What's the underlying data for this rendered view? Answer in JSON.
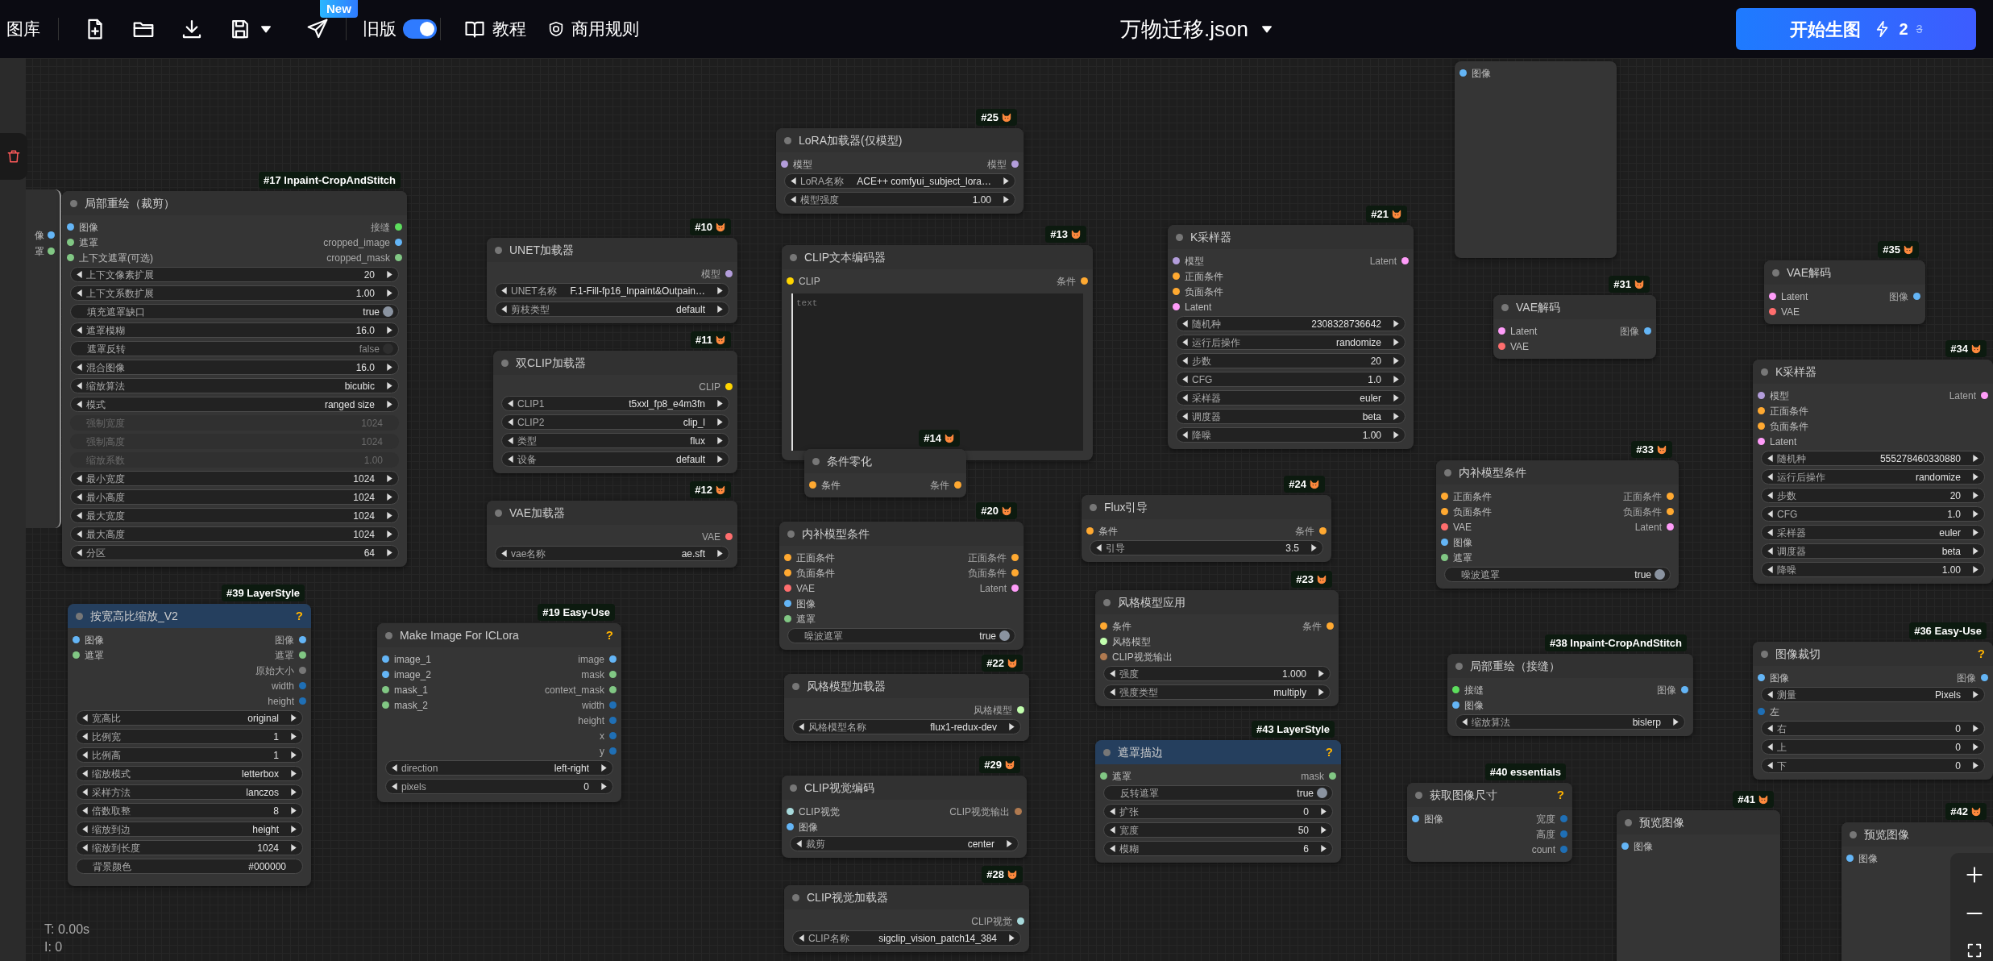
{
  "toolbar": {
    "gallery": "图库",
    "new_badge": "New",
    "old_version": {
      "label": "旧版",
      "on": true
    },
    "tutorial": "教程",
    "rules": "商用规则",
    "file_name": "万物迁移.json",
    "run": {
      "label": "开始生图",
      "count": "2",
      "old_count": "3"
    }
  },
  "left_stub": {
    "labels": [
      "像",
      "罩"
    ]
  },
  "nodes": [
    {
      "tag": "#17 Inpaint-CropAndStitch",
      "fox": false,
      "title": "局部重绘（裁剪）",
      "highlighted": false,
      "rows": [
        {
          "kind": "ports",
          "in": {
            "label": "图像",
            "color": "#64b5f6"
          },
          "out": {
            "label": "接缝",
            "color": "#5dde5d"
          }
        },
        {
          "kind": "ports",
          "in": {
            "label": "遮罩",
            "color": "#81c784"
          },
          "out": {
            "label": "cropped_image",
            "color": "#64b5f6"
          }
        },
        {
          "kind": "ports",
          "in": {
            "label": "上下文遮罩(可选)",
            "color": "#81c784"
          },
          "out": {
            "label": "cropped_mask",
            "color": "#81c784"
          }
        },
        {
          "kind": "stepper",
          "label": "上下文像素扩展",
          "value": "20"
        },
        {
          "kind": "stepper",
          "label": "上下文系数扩展",
          "value": "1.00"
        },
        {
          "kind": "toggle",
          "label": "填充遮罩缺口",
          "value": "true",
          "on": true
        },
        {
          "kind": "stepper",
          "label": "遮罩模糊",
          "value": "16.0"
        },
        {
          "kind": "toggle",
          "label": "遮罩反转",
          "value": "false",
          "on": false
        },
        {
          "kind": "stepper",
          "label": "混合图像",
          "value": "16.0"
        },
        {
          "kind": "stepper",
          "label": "缩放算法",
          "value": "bicubic"
        },
        {
          "kind": "stepper",
          "label": "模式",
          "value": "ranged size"
        },
        {
          "kind": "inactive",
          "label": "强制宽度",
          "value": "1024"
        },
        {
          "kind": "inactive",
          "label": "强制高度",
          "value": "1024"
        },
        {
          "kind": "inactive",
          "label": "缩放系数",
          "value": "1.00"
        },
        {
          "kind": "stepper",
          "label": "最小宽度",
          "value": "1024"
        },
        {
          "kind": "stepper",
          "label": "最小高度",
          "value": "1024"
        },
        {
          "kind": "stepper",
          "label": "最大宽度",
          "value": "1024"
        },
        {
          "kind": "stepper",
          "label": "最大高度",
          "value": "1024"
        },
        {
          "kind": "stepper",
          "label": "分区",
          "value": "64"
        }
      ]
    },
    {
      "tag": "#10",
      "fox": true,
      "title": "UNET加载器",
      "highlighted": false,
      "rows": [
        {
          "kind": "ports",
          "out": {
            "label": "模型",
            "color": "#b39ddb"
          }
        },
        {
          "kind": "stepper",
          "label": "UNET名称",
          "value": "F.1-Fill-fp16_Inpaint&Outpain…"
        },
        {
          "kind": "stepper",
          "label": "剪枝类型",
          "value": "default"
        }
      ]
    },
    {
      "tag": "#11",
      "fox": true,
      "title": "双CLIP加载器",
      "highlighted": false,
      "rows": [
        {
          "kind": "ports",
          "out": {
            "label": "CLIP",
            "color": "#ffd500"
          }
        },
        {
          "kind": "stepper",
          "label": "CLIP1",
          "value": "t5xxl_fp8_e4m3fn"
        },
        {
          "kind": "stepper",
          "label": "CLIP2",
          "value": "clip_l"
        },
        {
          "kind": "stepper",
          "label": "类型",
          "value": "flux"
        },
        {
          "kind": "stepper",
          "label": "设备",
          "value": "default"
        }
      ]
    },
    {
      "tag": "#12",
      "fox": true,
      "title": "VAE加载器",
      "highlighted": false,
      "rows": [
        {
          "kind": "ports",
          "out": {
            "label": "VAE",
            "color": "#ff6e6e"
          }
        },
        {
          "kind": "stepper",
          "label": "vae名称",
          "value": "ae.sft"
        }
      ]
    },
    {
      "tag": "#25",
      "fox": true,
      "title": "LoRA加载器(仅模型)",
      "highlighted": false,
      "rows": [
        {
          "kind": "ports",
          "in": {
            "label": "模型",
            "color": "#b39ddb"
          },
          "out": {
            "label": "模型",
            "color": "#b39ddb"
          }
        },
        {
          "kind": "stepper",
          "label": "LoRA名称",
          "value": "ACE++ comfyui_subject_lora…"
        },
        {
          "kind": "stepper",
          "label": "模型强度",
          "value": "1.00"
        }
      ]
    },
    {
      "tag": "#13",
      "fox": true,
      "title": "CLIP文本编码器",
      "highlighted": false,
      "rows": [
        {
          "kind": "ports",
          "in": {
            "label": "CLIP",
            "color": "#ffd500"
          },
          "out": {
            "label": "条件",
            "color": "#ffa931"
          }
        },
        {
          "kind": "textarea",
          "placeholder": "text"
        }
      ]
    },
    {
      "tag": "#14",
      "fox": true,
      "title": "条件零化",
      "highlighted": false,
      "rows": [
        {
          "kind": "ports",
          "in": {
            "label": "条件",
            "color": "#ffa931"
          },
          "out": {
            "label": "条件",
            "color": "#ffa931"
          }
        }
      ]
    },
    {
      "tag": "#21",
      "fox": true,
      "title": "K采样器",
      "highlighted": false,
      "rows": [
        {
          "kind": "ports",
          "in": {
            "label": "模型",
            "color": "#b39ddb"
          },
          "out": {
            "label": "Latent",
            "color": "#ff9cf9"
          }
        },
        {
          "kind": "ports",
          "in": {
            "label": "正面条件",
            "color": "#ffa931"
          }
        },
        {
          "kind": "ports",
          "in": {
            "label": "负面条件",
            "color": "#ffa931"
          }
        },
        {
          "kind": "ports",
          "in": {
            "label": "Latent",
            "color": "#ff9cf9"
          }
        },
        {
          "kind": "stepper",
          "label": "随机种",
          "value": "2308328736642"
        },
        {
          "kind": "stepper",
          "label": "运行后操作",
          "value": "randomize"
        },
        {
          "kind": "stepper",
          "label": "步数",
          "value": "20"
        },
        {
          "kind": "stepper",
          "label": "CFG",
          "value": "1.0"
        },
        {
          "kind": "stepper",
          "label": "采样器",
          "value": "euler"
        },
        {
          "kind": "stepper",
          "label": "调度器",
          "value": "beta"
        },
        {
          "kind": "stepper",
          "label": "降噪",
          "value": "1.00"
        }
      ]
    },
    {
      "rows": [
        {
          "kind": "ports",
          "in": {
            "label": "图像",
            "color": "#64b5f6"
          }
        }
      ]
    },
    {
      "tag": "#31",
      "fox": true,
      "title": "VAE解码",
      "highlighted": false,
      "rows": [
        {
          "kind": "ports",
          "in": {
            "label": "Latent",
            "color": "#ff9cf9"
          },
          "out": {
            "label": "图像",
            "color": "#64b5f6"
          }
        },
        {
          "kind": "ports",
          "in": {
            "label": "VAE",
            "color": "#ff6e6e"
          }
        }
      ]
    },
    {
      "tag": "#35",
      "fox": true,
      "title": "VAE解码",
      "highlighted": false,
      "rows": [
        {
          "kind": "ports",
          "in": {
            "label": "Latent",
            "color": "#ff9cf9"
          },
          "out": {
            "label": "图像",
            "color": "#64b5f6"
          }
        },
        {
          "kind": "ports",
          "in": {
            "label": "VAE",
            "color": "#ff6e6e"
          }
        }
      ]
    },
    {
      "tag": "#34",
      "fox": true,
      "title": "K采样器",
      "highlighted": false,
      "rows": [
        {
          "kind": "ports",
          "in": {
            "label": "模型",
            "color": "#b39ddb"
          },
          "out": {
            "label": "Latent",
            "color": "#ff9cf9"
          }
        },
        {
          "kind": "ports",
          "in": {
            "label": "正面条件",
            "color": "#ffa931"
          }
        },
        {
          "kind": "ports",
          "in": {
            "label": "负面条件",
            "color": "#ffa931"
          }
        },
        {
          "kind": "ports",
          "in": {
            "label": "Latent",
            "color": "#ff9cf9"
          }
        },
        {
          "kind": "stepper",
          "label": "随机种",
          "value": "555278460330880"
        },
        {
          "kind": "stepper",
          "label": "运行后操作",
          "value": "randomize"
        },
        {
          "kind": "stepper",
          "label": "步数",
          "value": "20"
        },
        {
          "kind": "stepper",
          "label": "CFG",
          "value": "1.0"
        },
        {
          "kind": "stepper",
          "label": "采样器",
          "value": "euler"
        },
        {
          "kind": "stepper",
          "label": "调度器",
          "value": "beta"
        },
        {
          "kind": "stepper",
          "label": "降噪",
          "value": "1.00"
        }
      ]
    },
    {
      "tag": "#24",
      "fox": true,
      "title": "Flux引导",
      "highlighted": false,
      "rows": [
        {
          "kind": "ports",
          "in": {
            "label": "条件",
            "color": "#ffa931"
          },
          "out": {
            "label": "条件",
            "color": "#ffa931"
          }
        },
        {
          "kind": "stepper",
          "label": "引导",
          "value": "3.5"
        }
      ]
    },
    {
      "tag": "#33",
      "fox": true,
      "title": "内补模型条件",
      "highlighted": false,
      "rows": [
        {
          "kind": "ports",
          "in": {
            "label": "正面条件",
            "color": "#ffa931"
          },
          "out": {
            "label": "正面条件",
            "color": "#ffa931"
          }
        },
        {
          "kind": "ports",
          "in": {
            "label": "负面条件",
            "color": "#ffa931"
          },
          "out": {
            "label": "负面条件",
            "color": "#ffa931"
          }
        },
        {
          "kind": "ports",
          "in": {
            "label": "VAE",
            "color": "#ff6e6e"
          },
          "out": {
            "label": "Latent",
            "color": "#ff9cf9"
          }
        },
        {
          "kind": "ports",
          "in": {
            "label": "图像",
            "color": "#64b5f6"
          }
        },
        {
          "kind": "ports",
          "in": {
            "label": "遮罩",
            "color": "#81c784"
          }
        },
        {
          "kind": "toggle",
          "label": "噪波遮罩",
          "value": "true",
          "on": true
        }
      ]
    },
    {
      "tag": "#20",
      "fox": true,
      "title": "内补模型条件",
      "highlighted": false,
      "rows": [
        {
          "kind": "ports",
          "in": {
            "label": "正面条件",
            "color": "#ffa931"
          },
          "out": {
            "label": "正面条件",
            "color": "#ffa931"
          }
        },
        {
          "kind": "ports",
          "in": {
            "label": "负面条件",
            "color": "#ffa931"
          },
          "out": {
            "label": "负面条件",
            "color": "#ffa931"
          }
        },
        {
          "kind": "ports",
          "in": {
            "label": "VAE",
            "color": "#ff6e6e"
          },
          "out": {
            "label": "Latent",
            "color": "#ff9cf9"
          }
        },
        {
          "kind": "ports",
          "in": {
            "label": "图像",
            "color": "#64b5f6"
          }
        },
        {
          "kind": "ports",
          "in": {
            "label": "遮罩",
            "color": "#81c784"
          }
        },
        {
          "kind": "toggle",
          "label": "噪波遮罩",
          "value": "true",
          "on": true
        }
      ]
    },
    {
      "tag": "#23",
      "fox": true,
      "title": "风格模型应用",
      "highlighted": false,
      "rows": [
        {
          "kind": "ports",
          "in": {
            "label": "条件",
            "color": "#ffa931"
          },
          "out": {
            "label": "条件",
            "color": "#ffa931"
          }
        },
        {
          "kind": "ports",
          "in": {
            "label": "风格模型",
            "color": "#c2ffae"
          }
        },
        {
          "kind": "ports",
          "in": {
            "label": "CLIP视觉输出",
            "color": "#b07a50"
          }
        },
        {
          "kind": "stepper",
          "label": "强度",
          "value": "1.000"
        },
        {
          "kind": "stepper",
          "label": "强度类型",
          "value": "multiply"
        }
      ]
    },
    {
      "tag": "#22",
      "fox": true,
      "title": "风格模型加载器",
      "highlighted": false,
      "rows": [
        {
          "kind": "ports",
          "out": {
            "label": "风格模型",
            "color": "#c2ffae"
          }
        },
        {
          "kind": "stepper",
          "label": "风格模型名称",
          "value": "flux1-redux-dev"
        }
      ]
    },
    {
      "tag": "#43 LayerStyle",
      "fox": false,
      "title": "遮罩描边",
      "highlighted": true,
      "help": "?",
      "rows": [
        {
          "kind": "ports",
          "in": {
            "label": "遮罩",
            "color": "#81c784"
          },
          "out": {
            "label": "mask",
            "color": "#81c784"
          }
        },
        {
          "kind": "toggle",
          "label": "反转遮罩",
          "value": "true",
          "on": true
        },
        {
          "kind": "stepper",
          "label": "扩张",
          "value": "0"
        },
        {
          "kind": "stepper",
          "label": "宽度",
          "value": "50"
        },
        {
          "kind": "stepper",
          "label": "模糊",
          "value": "6"
        }
      ]
    },
    {
      "tag": "#29",
      "fox": true,
      "title": "CLIP视觉编码",
      "highlighted": false,
      "rows": [
        {
          "kind": "ports",
          "in": {
            "label": "CLIP视觉",
            "color": "#a8dadc"
          },
          "out": {
            "label": "CLIP视觉输出",
            "color": "#b07a50"
          }
        },
        {
          "kind": "ports",
          "in": {
            "label": "图像",
            "color": "#64b5f6"
          }
        },
        {
          "kind": "stepper",
          "label": "裁剪",
          "value": "center"
        }
      ]
    },
    {
      "tag": "#28",
      "fox": true,
      "title": "CLIP视觉加载器",
      "highlighted": false,
      "rows": [
        {
          "kind": "ports",
          "out": {
            "label": "CLIP视觉",
            "color": "#a8dadc"
          }
        },
        {
          "kind": "stepper",
          "label": "CLIP名称",
          "value": "sigclip_vision_patch14_384"
        }
      ]
    },
    {
      "tag": "#39 LayerStyle",
      "fox": false,
      "title": "按宽高比缩放_V2",
      "highlighted": true,
      "help": "?",
      "rows": [
        {
          "kind": "ports",
          "in": {
            "label": "图像",
            "color": "#64b5f6"
          },
          "out": {
            "label": "图像",
            "color": "#64b5f6"
          }
        },
        {
          "kind": "ports",
          "in": {
            "label": "遮罩",
            "color": "#81c784"
          },
          "out": {
            "label": "遮罩",
            "color": "#81c784"
          }
        },
        {
          "kind": "ports",
          "out": {
            "label": "原始大小",
            "color": "#777777"
          }
        },
        {
          "kind": "ports",
          "out": {
            "label": "width",
            "color": "#1f6fb5"
          }
        },
        {
          "kind": "ports",
          "out": {
            "label": "height",
            "color": "#1f6fb5"
          }
        },
        {
          "kind": "stepper",
          "label": "宽高比",
          "value": "original"
        },
        {
          "kind": "stepper",
          "label": "比例宽",
          "value": "1"
        },
        {
          "kind": "stepper",
          "label": "比例高",
          "value": "1"
        },
        {
          "kind": "stepper",
          "label": "缩放模式",
          "value": "letterbox"
        },
        {
          "kind": "stepper",
          "label": "采样方法",
          "value": "lanczos"
        },
        {
          "kind": "stepper",
          "label": "倍数取整",
          "value": "8"
        },
        {
          "kind": "stepper",
          "label": "缩放到边",
          "value": "height"
        },
        {
          "kind": "stepper",
          "label": "缩放到长度",
          "value": "1024"
        },
        {
          "kind": "text",
          "label": "背景颜色",
          "value": "#000000"
        }
      ]
    },
    {
      "tag": "#19 Easy-Use",
      "fox": false,
      "title": "Make Image For ICLora",
      "highlighted": false,
      "help": "?",
      "rows": [
        {
          "kind": "ports",
          "in": {
            "label": "image_1",
            "color": "#64b5f6"
          },
          "out": {
            "label": "image",
            "color": "#64b5f6"
          }
        },
        {
          "kind": "ports",
          "in": {
            "label": "image_2",
            "color": "#64b5f6"
          },
          "out": {
            "label": "mask",
            "color": "#81c784"
          }
        },
        {
          "kind": "ports",
          "in": {
            "label": "mask_1",
            "color": "#81c784"
          },
          "out": {
            "label": "context_mask",
            "color": "#81c784"
          }
        },
        {
          "kind": "ports",
          "in": {
            "label": "mask_2",
            "color": "#81c784"
          },
          "out": {
            "label": "width",
            "color": "#1f6fb5"
          }
        },
        {
          "kind": "ports",
          "out": {
            "label": "height",
            "color": "#1f6fb5"
          }
        },
        {
          "kind": "ports",
          "out": {
            "label": "x",
            "color": "#1f6fb5"
          }
        },
        {
          "kind": "ports",
          "out": {
            "label": "y",
            "color": "#1f6fb5"
          }
        },
        {
          "kind": "stepper",
          "label": "direction",
          "value": "left-right"
        },
        {
          "kind": "stepper",
          "label": "pixels",
          "value": "0"
        }
      ]
    },
    {
      "tag": "#38 Inpaint-CropAndStitch",
      "fox": false,
      "title": "局部重绘（接缝）",
      "highlighted": false,
      "rows": [
        {
          "kind": "ports",
          "in": {
            "label": "接缝",
            "color": "#5dde5d"
          },
          "out": {
            "label": "图像",
            "color": "#64b5f6"
          }
        },
        {
          "kind": "ports",
          "in": {
            "label": "图像",
            "color": "#64b5f6"
          }
        },
        {
          "kind": "stepper",
          "label": "缩放算法",
          "value": "bislerp"
        }
      ]
    },
    {
      "tag": "#40 essentials",
      "fox": false,
      "title": "获取图像尺寸",
      "highlighted": false,
      "help": "?",
      "rows": [
        {
          "kind": "ports",
          "in": {
            "label": "图像",
            "color": "#64b5f6"
          },
          "out": {
            "label": "宽度",
            "color": "#1f6fb5"
          }
        },
        {
          "kind": "ports",
          "out": {
            "label": "高度",
            "color": "#1f6fb5"
          }
        },
        {
          "kind": "ports",
          "out": {
            "label": "count",
            "color": "#1f6fb5"
          }
        }
      ]
    },
    {
      "tag": "#41",
      "fox": true,
      "title": "预览图像",
      "highlighted": false,
      "rows": [
        {
          "kind": "ports",
          "in": {
            "label": "图像",
            "color": "#64b5f6"
          }
        }
      ]
    },
    {
      "tag": "#36 Easy-Use",
      "fox": false,
      "title": "图像裁切",
      "highlighted": false,
      "help": "?",
      "rows": [
        {
          "kind": "ports",
          "in": {
            "label": "图像",
            "color": "#64b5f6"
          },
          "out": {
            "label": "图像",
            "color": "#64b5f6"
          }
        },
        {
          "kind": "stepper",
          "label": "测量",
          "value": "Pixels"
        },
        {
          "kind": "ports",
          "in": {
            "label": "左",
            "color": "#1f6fb5"
          }
        },
        {
          "kind": "stepper",
          "label": "右",
          "value": "0"
        },
        {
          "kind": "stepper",
          "label": "上",
          "value": "0"
        },
        {
          "kind": "stepper",
          "label": "下",
          "value": "0"
        }
      ]
    },
    {
      "tag": "#42",
      "fox": true,
      "title": "预览图像",
      "highlighted": false,
      "rows": [
        {
          "kind": "ports",
          "in": {
            "label": "图像",
            "color": "#64b5f6"
          }
        }
      ]
    }
  ],
  "stats": [
    "T: 0.00s",
    "I: 0"
  ]
}
